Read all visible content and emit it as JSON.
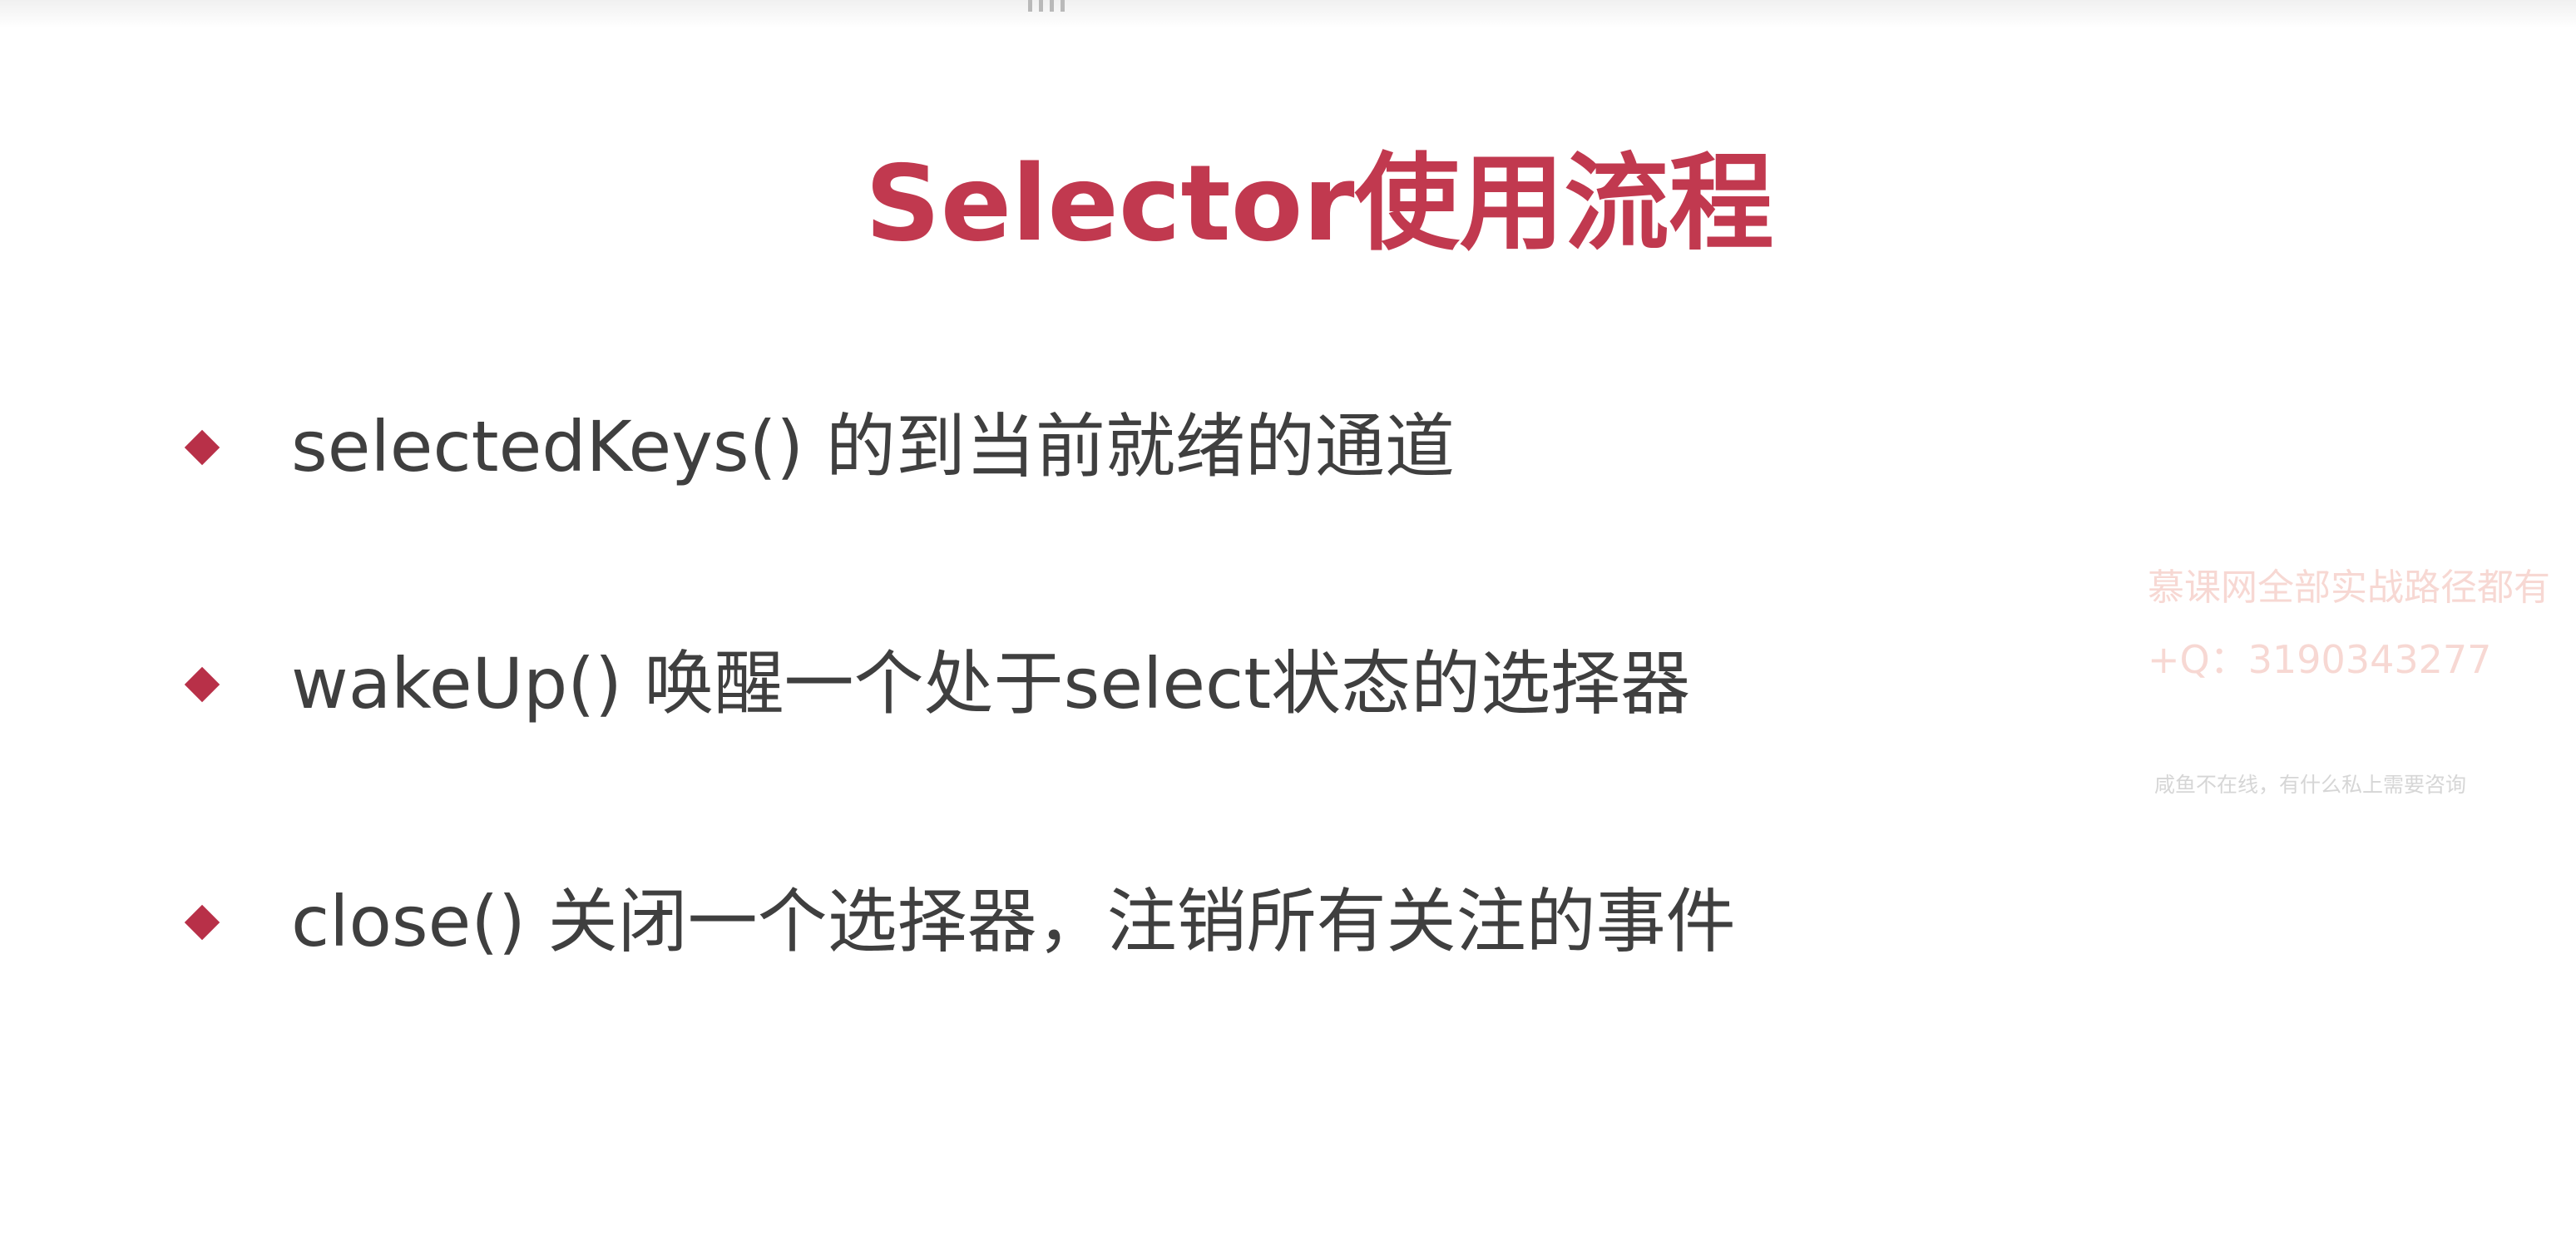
{
  "slide": {
    "title": "Selector使用流程",
    "bullets": [
      {
        "text": "selectedKeys() 的到当前就绪的通道"
      },
      {
        "text": "wakeUp() 唤醒一个处于select状态的选择器"
      },
      {
        "text": "close() 关闭一个选择器，注销所有关注的事件"
      }
    ]
  },
  "watermark": {
    "line1": "慕课网全部实战路径都有",
    "line2": "+Q：3190343277",
    "line3": "咸鱼不在线，有什么私上需要咨询"
  },
  "colors": {
    "title": "#c1394f",
    "bullet_marker": "#b83048",
    "body_text": "#3f3f3f",
    "watermark": "#f7d8d3"
  },
  "icons": {
    "bullet_marker": "diamond-icon",
    "top_handle": "drag-handle-icon"
  }
}
